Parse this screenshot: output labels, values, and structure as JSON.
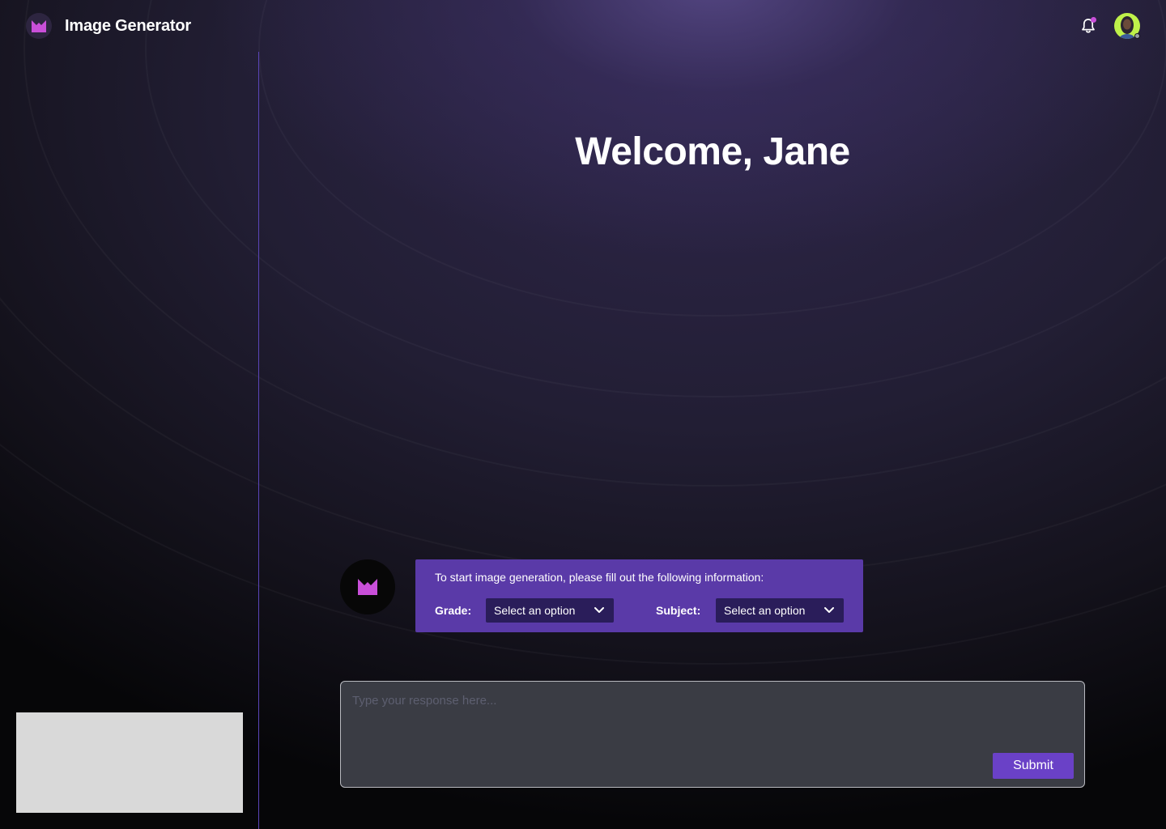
{
  "header": {
    "app_title": "Image Generator",
    "logo_icon": "m-logo-icon",
    "notification_icon": "bell-icon",
    "avatar_icon": "user-avatar"
  },
  "main": {
    "welcome": "Welcome, Jane"
  },
  "chat": {
    "bot_icon": "m-logo-icon",
    "message": "To start image generation, please fill out the following information:",
    "grade_label": "Grade:",
    "grade_value": "Select an option",
    "subject_label": "Subject:",
    "subject_value": "Select an option"
  },
  "composer": {
    "placeholder": "Type your response here...",
    "submit_label": "Submit"
  },
  "colors": {
    "accent": "#6a41c7",
    "card": "#5a3aa8",
    "logo": "#c94fd9",
    "avatar_bg": "#bff14a",
    "divider": "#5a45b8"
  }
}
